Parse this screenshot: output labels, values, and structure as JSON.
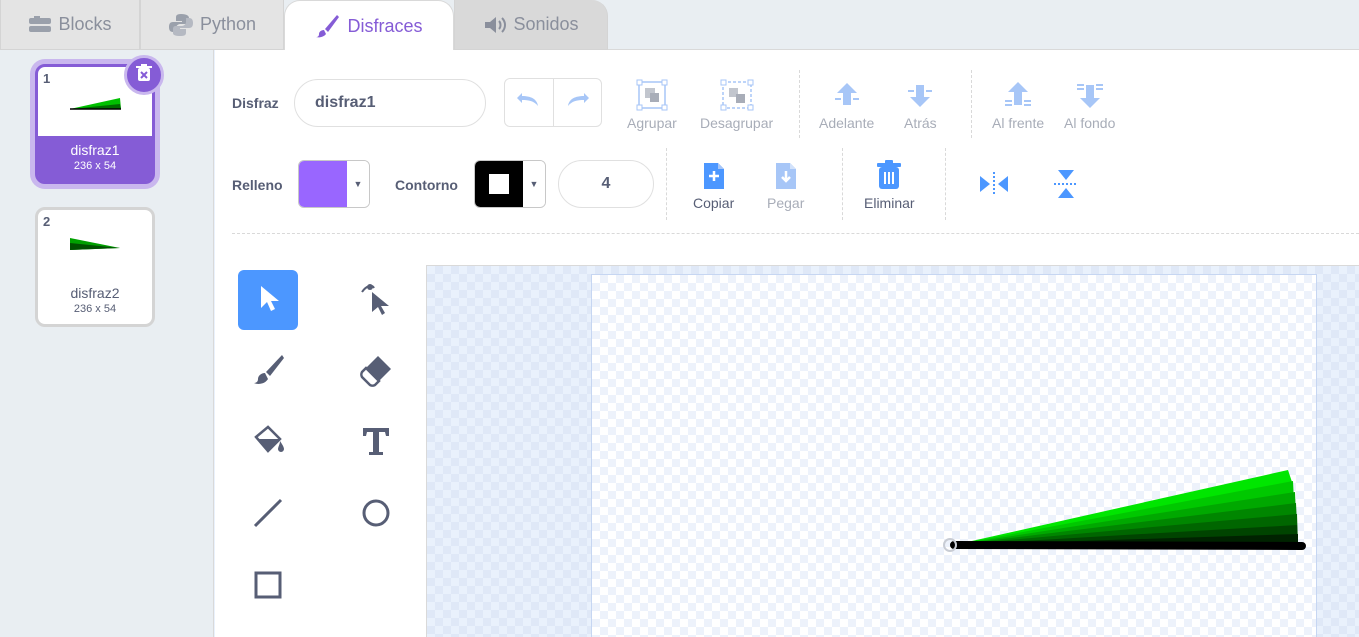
{
  "tabs": [
    {
      "label": "Blocks",
      "icon": "blocks-icon"
    },
    {
      "label": "Python",
      "icon": "python-icon"
    },
    {
      "label": "Disfraces",
      "icon": "brush-icon",
      "active": true
    },
    {
      "label": "Sonidos",
      "icon": "speaker-icon"
    }
  ],
  "costumes": [
    {
      "number": "1",
      "name": "disfraz1",
      "size": "236 x 54",
      "selected": true
    },
    {
      "number": "2",
      "name": "disfraz2",
      "size": "236 x 54",
      "selected": false
    }
  ],
  "toolbar": {
    "costume_label": "Disfraz",
    "costume_name": "disfraz1",
    "group": "Agrupar",
    "ungroup": "Desagrupar",
    "forward": "Adelante",
    "backward": "Atrás",
    "front": "Al frente",
    "back": "Al fondo",
    "fill_label": "Relleno",
    "fill_color": "#9966ff",
    "outline_label": "Contorno",
    "outline_color": "#000000",
    "outline_width": "4",
    "copy": "Copiar",
    "paste": "Pegar",
    "delete": "Eliminar"
  },
  "colors": {
    "accent": "#855cd6",
    "tool_active": "#4c97ff",
    "icon_blue": "#4c97ff",
    "disabled": "#a8adb8"
  },
  "tools": [
    "select-icon",
    "reshape-icon",
    "brush-icon",
    "eraser-icon",
    "fill-icon",
    "text-icon",
    "line-icon",
    "circle-icon",
    "rectangle-icon"
  ]
}
